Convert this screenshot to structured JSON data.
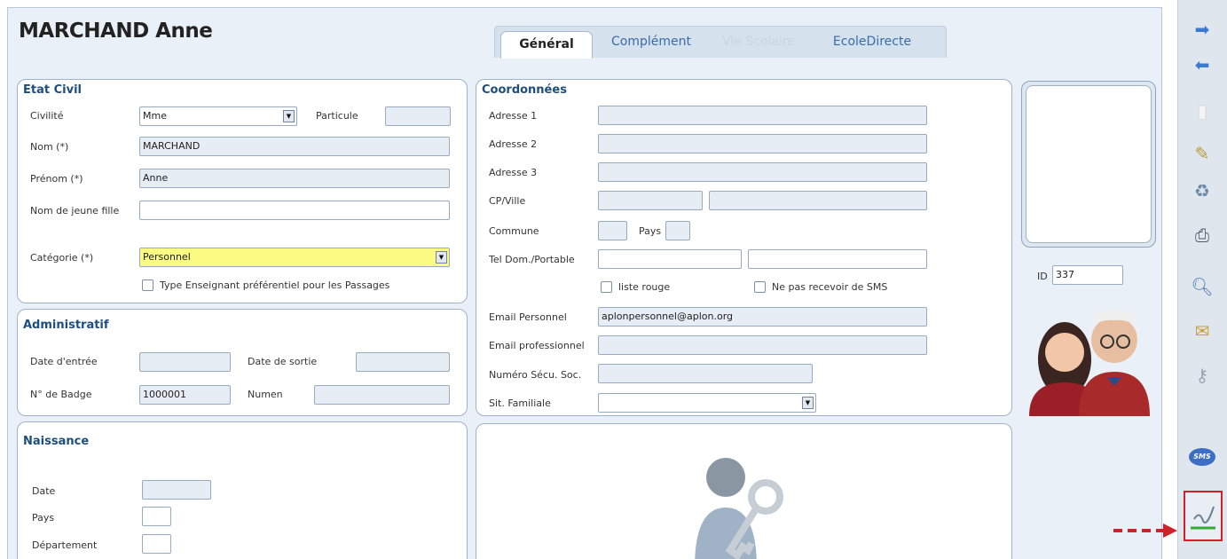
{
  "header": {
    "title": "MARCHAND Anne"
  },
  "tabs": [
    {
      "label": "Général",
      "state": "active"
    },
    {
      "label": "Complément",
      "state": "normal"
    },
    {
      "label": "Vie Scolaire",
      "state": "disabled"
    },
    {
      "label": "EcoleDirecte",
      "state": "normal"
    }
  ],
  "etat_civil": {
    "title": "Etat Civil",
    "civilite_label": "Civilité",
    "civilite_value": "Mme",
    "particule_label": "Particule",
    "particule_value": "",
    "nom_label": "Nom (*)",
    "nom_value": "MARCHAND",
    "prenom_label": "Prénom (*)",
    "prenom_value": "Anne",
    "jeune_fille_label": "Nom de jeune fille",
    "jeune_fille_value": "",
    "categorie_label": "Catégorie (*)",
    "categorie_value": "Personnel",
    "type_enseignant_label": "Type Enseignant préférentiel pour les Passages",
    "type_enseignant_checked": false
  },
  "administratif": {
    "title": "Administratif",
    "date_entree_label": "Date d'entrée",
    "date_entree_value": "",
    "date_sortie_label": "Date de sortie",
    "date_sortie_value": "",
    "badge_label": "N° de Badge",
    "badge_value": "1000001",
    "numen_label": "Numen",
    "numen_value": ""
  },
  "naissance": {
    "title": "Naissance",
    "date_label": "Date",
    "pays_label": "Pays",
    "departement_label": "Département"
  },
  "coordonnees": {
    "title": "Coordonnées",
    "adresse1_label": "Adresse 1",
    "adresse2_label": "Adresse 2",
    "adresse3_label": "Adresse 3",
    "cp_ville_label": "CP/Ville",
    "commune_label": "Commune",
    "pays_label": "Pays",
    "tel_label": "Tel Dom./Portable",
    "liste_rouge_label": "liste rouge",
    "liste_rouge_checked": false,
    "no_sms_label": "Ne pas recevoir de SMS",
    "no_sms_checked": false,
    "email_perso_label": "Email Personnel",
    "email_perso_value": "aplonpersonnel@aplon.org",
    "email_pro_label": "Email professionnel",
    "email_pro_value": "",
    "secu_label": "Numéro Sécu. Soc.",
    "secu_value": "",
    "sit_familiale_label": "Sit. Familiale",
    "sit_familiale_value": ""
  },
  "id_field": {
    "label": "ID",
    "value": "337"
  },
  "toolbar": {
    "icons": [
      "forward-arrow-icon",
      "back-arrow-icon",
      "new-document-icon",
      "edit-pen-icon",
      "recycle-bin-icon",
      "print-icon",
      "search-magnifier-icon",
      "mail-icon",
      "key-user-icon",
      "sms-icon",
      "signature-icon"
    ],
    "sms_label": "SMS"
  },
  "colors": {
    "accent": "#1d4e7e",
    "tab_link": "#3a6da8",
    "required_highlight": "#fbfa82",
    "active_marker": "#d0202a"
  }
}
